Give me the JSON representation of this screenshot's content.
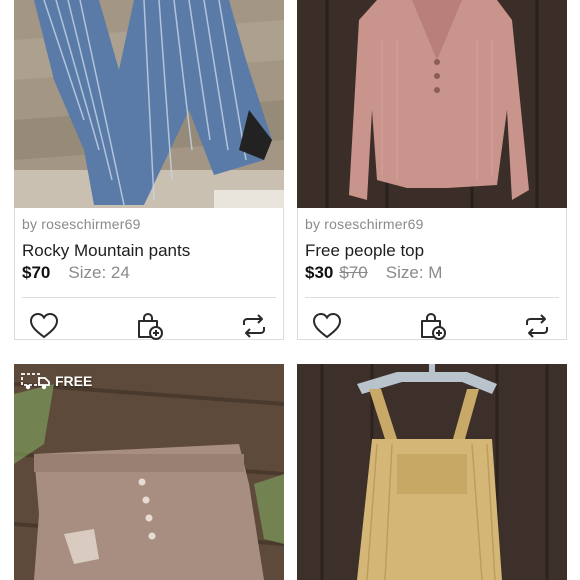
{
  "listings": [
    {
      "seller": "by roseschirmer69",
      "title": "Rocky Mountain pants",
      "price": "$70",
      "original_price": "",
      "size": "Size: 24",
      "image_icon": "striped-jeans-photo"
    },
    {
      "seller": "by roseschirmer69",
      "title": "Free people top",
      "price": "$30",
      "original_price": "$70",
      "size": "Size: M",
      "image_icon": "pink-henley-top-photo"
    },
    {
      "badge": "FREE",
      "badge_icon": "truck-icon",
      "image_icon": "denim-shorts-photo"
    },
    {
      "image_icon": "yellow-overalls-photo"
    }
  ],
  "actions": {
    "like_icon": "heart-icon",
    "bundle_icon": "bag-add-icon",
    "share_icon": "share-icon"
  },
  "colors": {
    "text": "#1e1e1e",
    "muted": "#8a8a8a",
    "border": "#dcdcdc",
    "icon": "#2a2a2a"
  }
}
